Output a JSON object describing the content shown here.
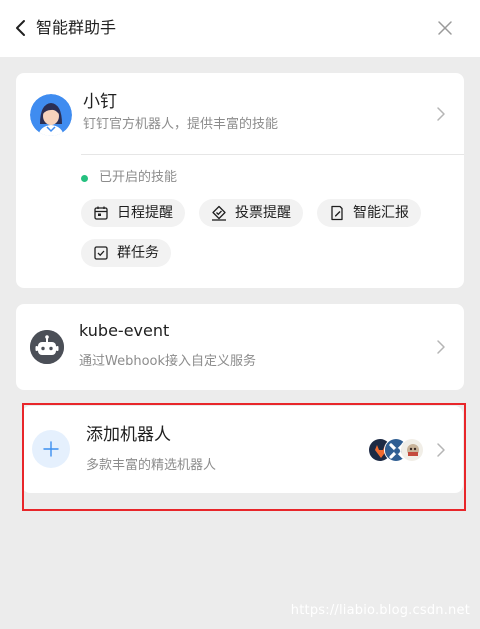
{
  "header": {
    "title": "智能群助手",
    "back_icon": "chevron-left-icon",
    "close_icon": "close-icon"
  },
  "xiaoding": {
    "name": "小钉",
    "description": "钉钉官方机器人，提供丰富的技能",
    "skills_status": "已开启的技能",
    "status_color": "#25c07f",
    "skills": [
      {
        "label": "日程提醒",
        "icon": "calendar-icon"
      },
      {
        "label": "投票提醒",
        "icon": "vote-icon"
      },
      {
        "label": "智能汇报",
        "icon": "report-icon"
      },
      {
        "label": "群任务",
        "icon": "task-checkbox-icon"
      }
    ]
  },
  "kube_event": {
    "name": "kube-event",
    "description": "通过Webhook接入自定义服务"
  },
  "add_robot": {
    "title": "添加机器人",
    "description": "多款丰富的精选机器人",
    "accent_color": "#3d8ff0"
  },
  "highlight_color": "#e8262a",
  "watermark": "https://liabio.blog.csdn.net"
}
